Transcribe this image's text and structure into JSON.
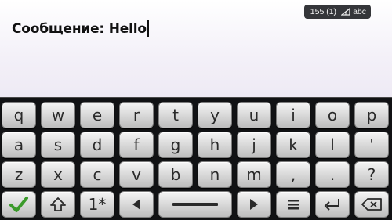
{
  "status": {
    "counter": "155 (1)",
    "input_mode": "abc"
  },
  "editor": {
    "message": "Сообщение: Hello"
  },
  "keyboard": {
    "rows": [
      [
        "q",
        "w",
        "e",
        "r",
        "t",
        "y",
        "u",
        "i",
        "o",
        "p"
      ],
      [
        "a",
        "s",
        "d",
        "f",
        "g",
        "h",
        "j",
        "k",
        "l",
        "'"
      ],
      [
        "z",
        "x",
        "c",
        "v",
        "b",
        "n",
        "m",
        ",",
        ".",
        "?"
      ]
    ],
    "bottom": {
      "numbers_label": "1*",
      "accept_icon": "checkmark-icon",
      "shift_icon": "shift-arrow-icon",
      "left_icon": "left-arrow-icon",
      "space_icon": "spacebar-icon",
      "right_icon": "right-arrow-icon",
      "menu_icon": "menu-lines-icon",
      "enter_icon": "enter-icon",
      "backspace_icon": "backspace-icon"
    },
    "colors": {
      "accept": "#3a9a2a",
      "background": "#111214"
    }
  }
}
